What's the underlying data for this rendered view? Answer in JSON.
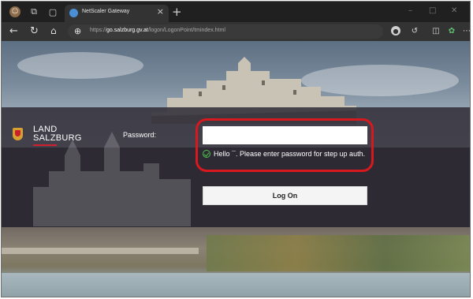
{
  "browser": {
    "tab_title": "NetScaler Gateway",
    "tab_close": "×",
    "new_tab": "+",
    "url_prefix": "https://",
    "url_domain": "go.salzburg.gv.at",
    "url_path": "/logon/LogonPoint/tmindex.html",
    "icons": [
      "profile-icon",
      "workspaces-icon",
      "tab-actions-icon",
      "back-icon",
      "reload-icon",
      "home-icon",
      "site-info-icon",
      "extension-icon",
      "copilot-icon",
      "split-screen-icon",
      "favorites-icon",
      "more-icon",
      "minimize-icon",
      "maximize-icon",
      "close-icon"
    ]
  },
  "page": {
    "logo": {
      "line1": "LAND",
      "line2": "SALZBURG",
      "accent_color": "#d02030"
    },
    "password_label": "Password:",
    "password_value": "",
    "message": "Hello   ¯. Please enter password for step up auth.",
    "logon_button": "Log On",
    "highlight_color": "#d7191f",
    "message_icon_color": "#4cc24c"
  }
}
